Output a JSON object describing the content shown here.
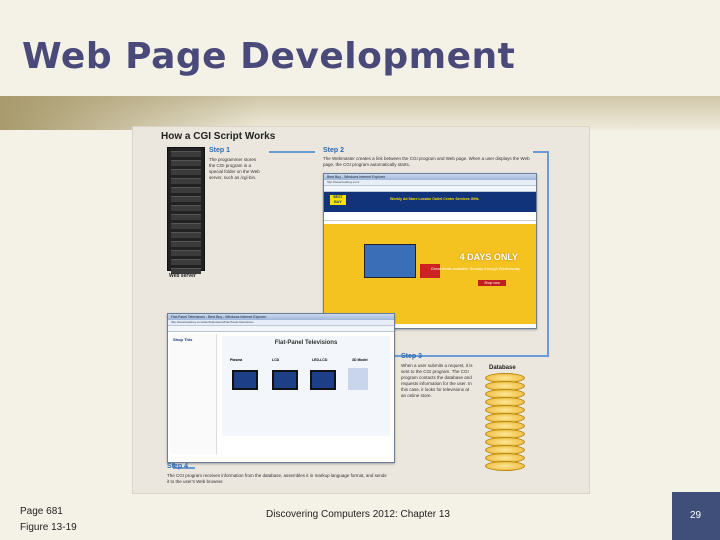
{
  "slide": {
    "title": "Web Page Development",
    "footer_page_ref": "Page 681",
    "footer_figure_ref": "Figure 13-19",
    "footer_course": "Discovering Computers 2012: Chapter 13",
    "page_number": "29"
  },
  "figure": {
    "title": "How a CGI Script Works",
    "server_label": "Web server",
    "database_label": "Database",
    "step1": {
      "heading": "Step 1",
      "text": "The programmer stores the CGI program in a special folder on the Web server, such as /cgi-bin."
    },
    "step2": {
      "heading": "Step 2",
      "text": "The Webmaster creates a link between the CGI program and Web page. When a user displays the Web page, the CGI program automatically starts."
    },
    "step3": {
      "heading": "Step 3",
      "text": "When a user submits a request, it is sent to the CGI program. The CGI program contacts the database and requests information for the user. In this case, it looks for televisions at an online store."
    },
    "step4": {
      "heading": "Step 4",
      "text": "The CGI program receives information from the database, assembles it in markup language format, and sends it to the user's Web browser."
    },
    "browser1": {
      "titlebar": "Best Buy - Windows Internet Explorer",
      "nav": "http://www.bestbuy.com/",
      "menu": "Weekly Ad   Store Locator   Outlet Center   Services   Gifts",
      "banner_heading": "4 DAYS ONLY",
      "banner_sub": "Great deals available Sunday through Wednesday",
      "banner_button": "Shop now"
    },
    "browser2": {
      "titlebar": "Flat-Panel Televisions - Best Buy - Windows Internet Explorer",
      "nav": "http://www.bestbuy.com/site/Televisions/Flat-Panel-Televisions",
      "heading": "Flat-Panel Televisions",
      "sidebar_heading": "Shop This",
      "categories": [
        "Plasma",
        "LCD",
        "LED-LCD",
        "3D Model"
      ]
    }
  }
}
